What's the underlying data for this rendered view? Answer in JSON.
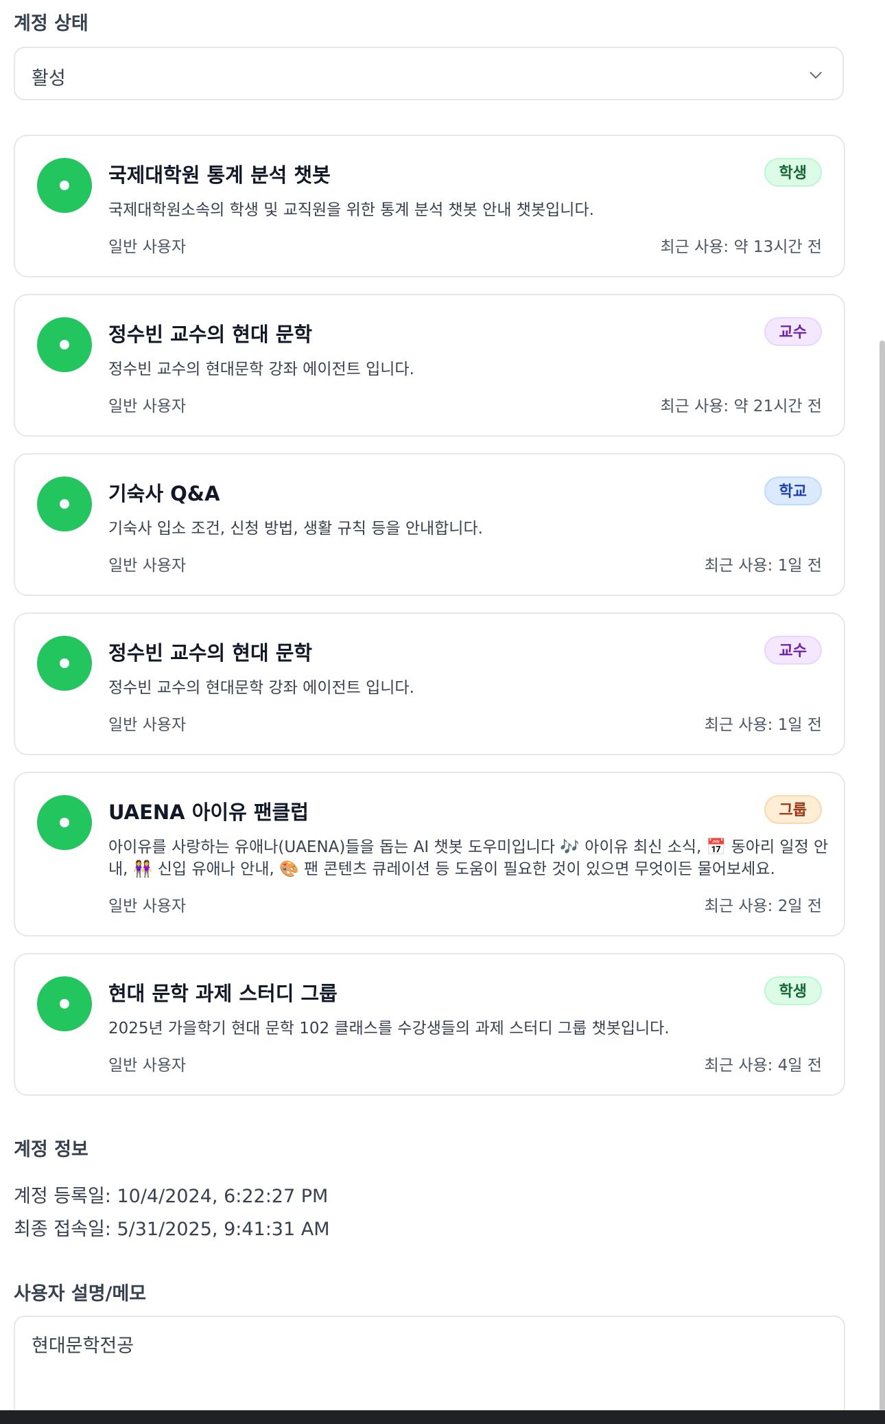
{
  "account_status": {
    "label": "계정 상태",
    "selected": "활성"
  },
  "agents": [
    {
      "title": "국제대학원 통계 분석 챗봇",
      "badge": "학생",
      "description": "국제대학원소속의 학생 및 교직원을 위한 통계 분석 챗봇 안내 챗봇입니다.",
      "role": "일반 사용자",
      "last_used": "최근 사용: 약 13시간 전"
    },
    {
      "title": "정수빈 교수의 현대 문학",
      "badge": "교수",
      "description": "정수빈 교수의 현대문학 강좌 에이전트 입니다.",
      "role": "일반 사용자",
      "last_used": "최근 사용: 약 21시간 전"
    },
    {
      "title": "기숙사 Q&A",
      "badge": "학교",
      "description": "기숙사 입소 조건, 신청 방법, 생활 규칙 등을 안내합니다.",
      "role": "일반 사용자",
      "last_used": "최근 사용: 1일 전"
    },
    {
      "title": "정수빈 교수의 현대 문학",
      "badge": "교수",
      "description": "정수빈 교수의 현대문학 강좌 에이전트 입니다.",
      "role": "일반 사용자",
      "last_used": "최근 사용: 1일 전"
    },
    {
      "title": "UAENA 아이유 팬클럽",
      "badge": "그룹",
      "description": "아이유를 사랑하는 유애나(UAENA)들을 돕는 AI 챗봇 도우미입니다 🎶 아이유 최신 소식, 📅 동아리 일정 안내, 👭 신입 유애나 안내, 🎨 팬 콘텐츠 큐레이션 등 도움이 필요한 것이 있으면 무엇이든 물어보세요.",
      "role": "일반 사용자",
      "last_used": "최근 사용: 2일 전"
    },
    {
      "title": "현대 문학 과제 스터디 그룹",
      "badge": "학생",
      "description": "2025년 가을학기 현대 문학 102 클래스를 수강생들의 과제 스터디 그룹 챗봇입니다.",
      "role": "일반 사용자",
      "last_used": "최근 사용: 4일 전"
    }
  ],
  "account_info": {
    "label": "계정 정보",
    "registered": "계정 등록일: 10/4/2024, 6:22:27 PM",
    "last_login": "최종 접속일: 5/31/2025, 9:41:31 AM"
  },
  "memo": {
    "label": "사용자 설명/메모",
    "value": "현대문학전공"
  },
  "colors": {
    "avatar": "#22c55e",
    "badge_student": "#dcfce7",
    "badge_professor": "#f3e8ff",
    "badge_school": "#dbeafe",
    "badge_group": "#ffedd5"
  }
}
